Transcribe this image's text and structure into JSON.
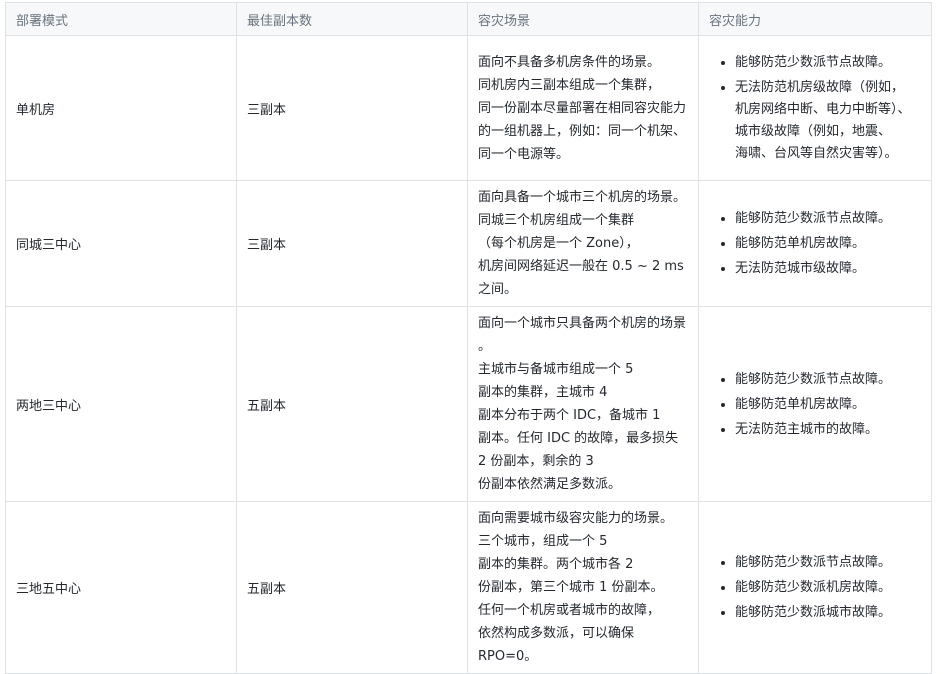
{
  "table": {
    "headers": [
      "部署模式",
      "最佳副本数",
      "容灾场景",
      "容灾能力"
    ],
    "rows": [
      {
        "mode": "单机房",
        "replicas": "三副本",
        "scenario_lines": [
          "面向不具备多机房条件的场景。",
          "同机房内三副本组成一个集群，",
          "同一份副本尽量部署在相同容灾能力",
          "的一组机器上，例如：同一个机架、",
          "同一个电源等。"
        ],
        "capabilities": [
          [
            "能够防范少数派节点故障。"
          ],
          [
            "无法防范机房级故障（例如，",
            "机房网络中断、电力中断等）、",
            "城市级故障（例如，地震、",
            "海啸、台风等自然灾害等）。"
          ]
        ]
      },
      {
        "mode": "同城三中心",
        "replicas": "三副本",
        "scenario_lines": [
          "面向具备一个城市三个机房的场景。",
          "同城三个机房组成一个集群",
          "（每个机房是一个 Zone），",
          "机房间网络延迟一般在 0.5 ~ 2 ms",
          "之间。"
        ],
        "capabilities": [
          [
            "能够防范少数派节点故障。"
          ],
          [
            "能够防范单机房故障。"
          ],
          [
            "无法防范城市级故障。"
          ]
        ]
      },
      {
        "mode": "两地三中心",
        "replicas": "五副本",
        "scenario_lines": [
          "面向一个城市只具备两个机房的场景",
          "。",
          "主城市与备城市组成一个 5",
          "副本的集群，主城市 4",
          "副本分布于两个 IDC，备城市 1",
          "副本。任何 IDC 的故障，最多损失",
          "2 份副本，剩余的 3",
          "份副本依然满足多数派。"
        ],
        "capabilities": [
          [
            "能够防范少数派节点故障。"
          ],
          [
            "能够防范单机房故障。"
          ],
          [
            "无法防范主城市的故障。"
          ]
        ]
      },
      {
        "mode": "三地五中心",
        "replicas": "五副本",
        "scenario_lines": [
          "面向需要城市级容灾能力的场景。",
          "三个城市，组成一个 5",
          "副本的集群。两个城市各 2",
          "份副本，第三个城市 1 份副本。",
          "任何一个机房或者城市的故障，",
          "依然构成多数派，可以确保",
          "RPO=0。"
        ],
        "capabilities": [
          [
            "能够防范少数派节点故障。"
          ],
          [
            "能够防范少数派机房故障。"
          ],
          [
            "能够防范少数派城市故障。"
          ]
        ]
      }
    ]
  }
}
